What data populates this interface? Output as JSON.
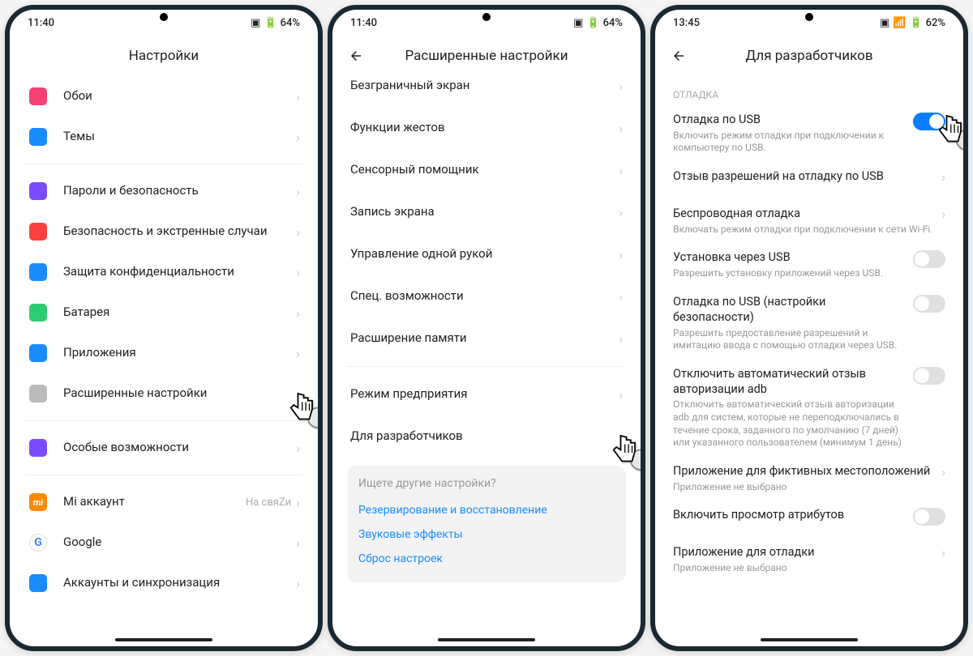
{
  "screens": [
    {
      "id": "s1",
      "status": {
        "time": "11:40",
        "batt": "64%",
        "alarmIcon": "alarm",
        "battBox": "⊡",
        "wifi": false
      },
      "title": "Настройки",
      "back": false,
      "sections": [
        {
          "rows": [
            {
              "icon": "wallpaper",
              "color": "#f54272",
              "label": "Обои"
            },
            {
              "icon": "theme",
              "color": "#1a8cff",
              "label": "Темы"
            }
          ]
        },
        {
          "rows": [
            {
              "icon": "fingerprint",
              "color": "#7a4cff",
              "label": "Пароли и безопасность"
            },
            {
              "icon": "sos",
              "color": "#ff4040",
              "label": "Безопасность и экстренные случаи"
            },
            {
              "icon": "shield",
              "color": "#1a8cff",
              "label": "Защита конфиденциальности"
            },
            {
              "icon": "battery",
              "color": "#2ecc71",
              "label": "Батарея"
            },
            {
              "icon": "apps",
              "color": "#1a8cff",
              "label": "Приложения"
            },
            {
              "icon": "advanced",
              "color": "#bbb",
              "label": "Расширенные настройки",
              "cursor": true
            }
          ]
        },
        {
          "rows": [
            {
              "icon": "accessibility",
              "color": "#7a4cff",
              "label": "Особые возможности"
            }
          ]
        },
        {
          "rows": [
            {
              "icon": "mi",
              "color": "#ff8a00",
              "label": "Mi аккаунт",
              "value": "На свяZи"
            },
            {
              "icon": "google",
              "color": "#fff",
              "label": "Google"
            },
            {
              "icon": "account",
              "color": "#1a8cff",
              "label": "Аккаунты и синхронизация"
            }
          ]
        }
      ]
    },
    {
      "id": "s2",
      "status": {
        "time": "11:40",
        "batt": "64%",
        "alarmIcon": "alarm",
        "battBox": "⊡",
        "wifi": false
      },
      "title": "Расширенные настройки",
      "back": true,
      "sections": [
        {
          "rows": [
            {
              "label": "Безграничный экран",
              "clip": true
            },
            {
              "label": "Функции жестов"
            },
            {
              "label": "Сенсорный помощник"
            },
            {
              "label": "Запись экрана"
            },
            {
              "label": "Управление одной рукой"
            },
            {
              "label": "Спец. возможности"
            },
            {
              "label": "Расширение памяти"
            }
          ]
        },
        {
          "rows": [
            {
              "label": "Режим предприятия"
            },
            {
              "label": "Для разработчиков",
              "cursor": true
            }
          ]
        }
      ],
      "searchMore": {
        "title": "Ищете другие настройки?",
        "links": [
          "Резервирование и восстановление",
          "Звуковые эффекты",
          "Сброс настроек"
        ]
      }
    },
    {
      "id": "s3",
      "status": {
        "time": "13:45",
        "batt": "62%",
        "alarmIcon": "alarm",
        "battBox": "⊡",
        "wifi": true
      },
      "title": "Для разработчиков",
      "back": true,
      "sectionHeader": "ОТЛАДКА",
      "devRows": [
        {
          "label": "Отладка по USB",
          "sub": "Включить режим отладки при подключении к компьютеру по USB.",
          "control": "toggle",
          "on": true,
          "cursor": true
        },
        {
          "label": "Отзыв разрешений на отладку по USB",
          "control": "chev"
        },
        {
          "label": "Беспроводная отладка",
          "sub": "Включать режим отладки при подключении к сети Wi-Fi.",
          "control": "chev"
        },
        {
          "label": "Установка через USB",
          "sub": "Разрешить установку приложений через USB.",
          "control": "toggle",
          "on": false
        },
        {
          "label": "Отладка по USB (настройки безопасности)",
          "sub": "Разрешить предоставление разрешений и имитацию ввода с помощью отладки через USB.",
          "control": "toggle",
          "on": false
        },
        {
          "label": "Отключить автоматический отзыв авторизации adb",
          "sub": "Отключить автоматический отзыв авторизации adb для систем, которые не переподключались в течение срока, заданного по умолчанию (7 дней) или указанного пользователем (минимум 1 день)",
          "control": "toggle",
          "on": false
        },
        {
          "label": "Приложение для фиктивных местоположений",
          "sub": "Приложение не выбрано",
          "control": "chev"
        },
        {
          "label": "Включить просмотр атрибутов",
          "control": "toggle",
          "on": false
        },
        {
          "label": "Приложение для отладки",
          "sub": "Приложение не выбрано",
          "control": "chev",
          "clip": true
        }
      ]
    }
  ]
}
